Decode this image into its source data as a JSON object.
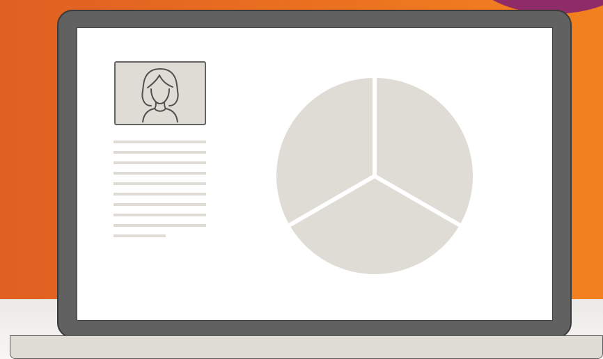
{
  "colors": {
    "background_left": "#e05f22",
    "background_right": "#f3811f",
    "accent_blob": "#8f2c67",
    "laptop_bezel": "#616161",
    "laptop_outline": "#3a3a3a",
    "screen": "#ffffff",
    "placeholder": "#dedcd4",
    "avatar_stroke": "#4f4f4f"
  },
  "profile": {
    "icon": "woman-avatar-icon"
  },
  "document": {
    "line_count": 10
  },
  "chart_data": {
    "type": "pie",
    "values": [
      1,
      1,
      1
    ],
    "slice_color": "#dedcd4",
    "separator_color": "#ffffff"
  }
}
